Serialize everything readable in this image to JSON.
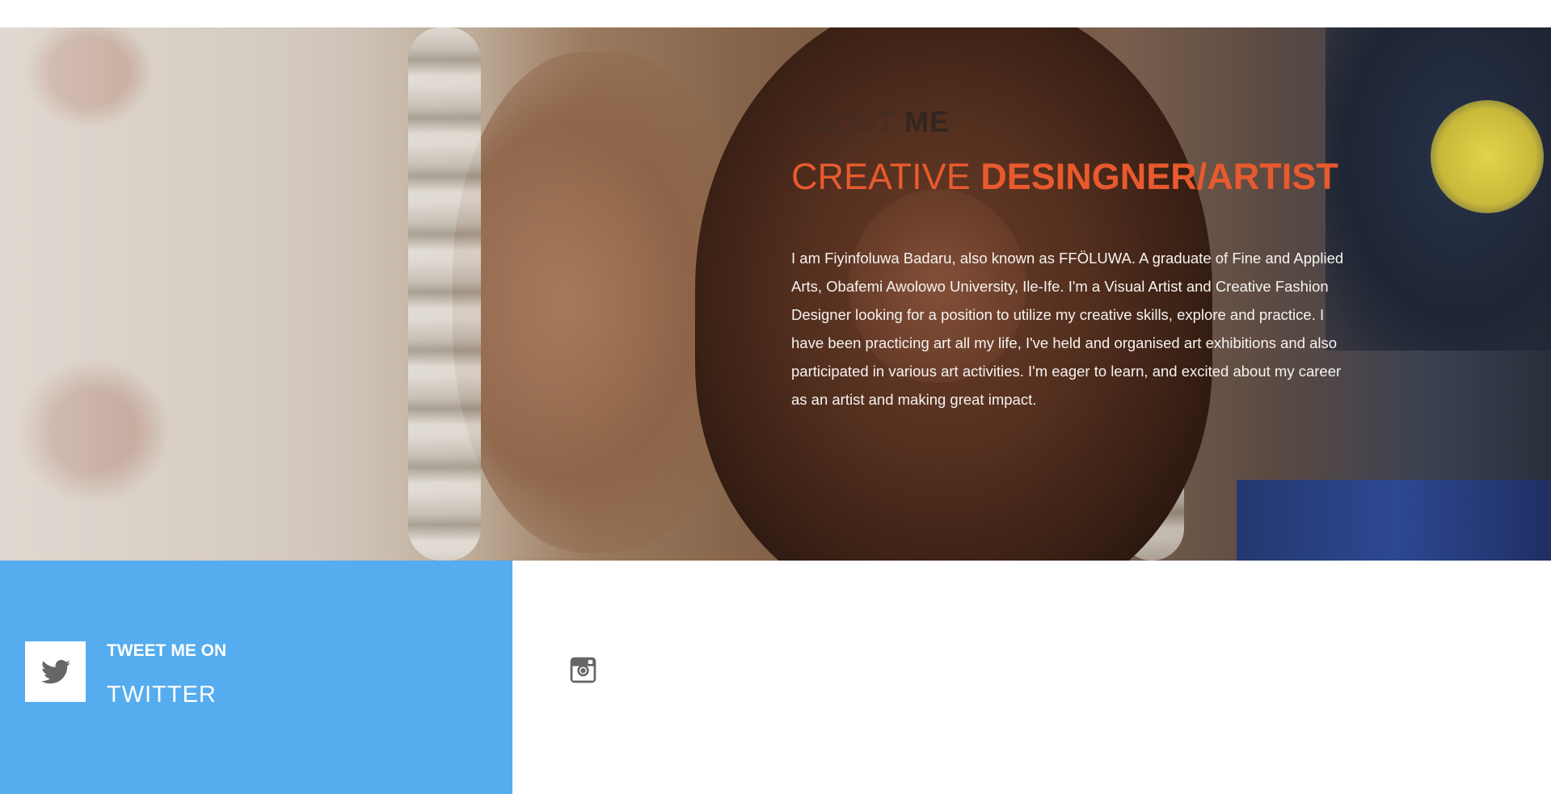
{
  "hero": {
    "about_light": "ABOUT",
    "about_bold": "ME",
    "headline_light": "CREATIVE",
    "headline_bold": "DESINGNER/ARTIST",
    "bio": "I am Fiyinfoluwa Badaru, also known as FFÖLUWA. A graduate of Fine and Applied Arts, Obafemi Awolowo University, Ile-Ife. I'm a Visual Artist and Creative Fashion Designer looking for a position to utilize my creative skills, explore and practice. I have been practicing art all my life, I've held and organised art exhibitions and also participated in various art activities. I'm eager to learn, and excited about my career as an artist and making great impact.",
    "accent_color": "#e85a2e"
  },
  "twitter": {
    "label": "TWEET ME ON",
    "platform": "TWITTER",
    "icon": "twitter-bird-icon",
    "color": "#55acee"
  },
  "instagram": {
    "icon": "instagram-icon"
  }
}
